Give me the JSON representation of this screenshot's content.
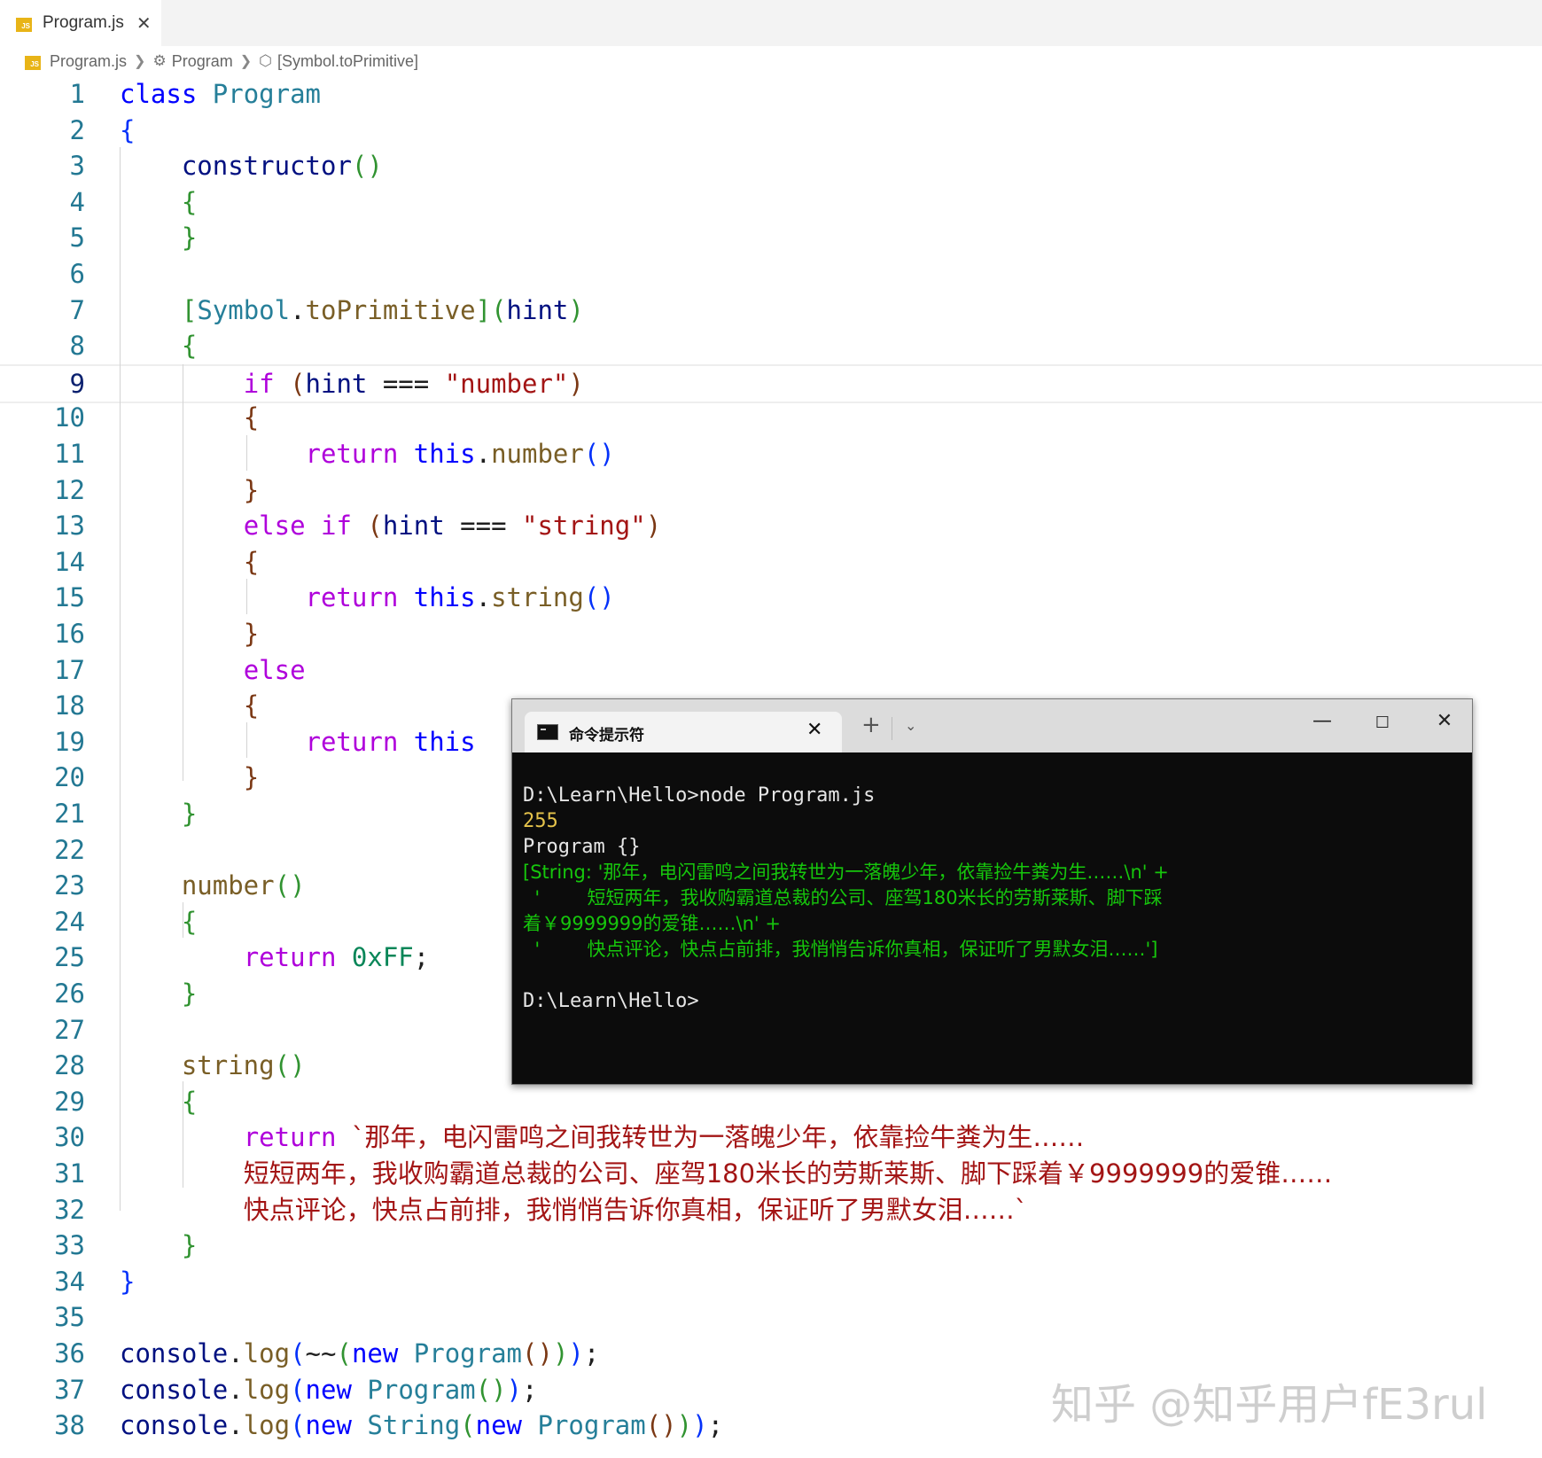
{
  "tab": {
    "filename": "Program.js"
  },
  "breadcrumb": {
    "file": "Program.js",
    "class": "Program",
    "member": "[Symbol.toPrimitive]"
  },
  "editor": {
    "active_line": 9,
    "lines": [
      {
        "n": "1",
        "parts": [
          [
            "kw",
            "class"
          ],
          [
            "",
            " "
          ],
          [
            "ty",
            "Program"
          ]
        ]
      },
      {
        "n": "2",
        "parts": [
          [
            "p1",
            "{"
          ]
        ]
      },
      {
        "n": "3",
        "parts": [
          [
            "",
            "    "
          ],
          [
            "vr",
            "constructor"
          ],
          [
            "p2",
            "()"
          ]
        ]
      },
      {
        "n": "4",
        "parts": [
          [
            "",
            "    "
          ],
          [
            "p2",
            "{"
          ]
        ]
      },
      {
        "n": "5",
        "parts": [
          [
            "",
            "    "
          ],
          [
            "p2",
            "}"
          ]
        ]
      },
      {
        "n": "6",
        "parts": []
      },
      {
        "n": "7",
        "parts": [
          [
            "",
            "    "
          ],
          [
            "p2",
            "["
          ],
          [
            "ty",
            "Symbol"
          ],
          [
            "",
            ".",
            ""
          ],
          [
            "fnb",
            "toPrimitive"
          ],
          [
            "p2",
            "]"
          ],
          [
            "p2",
            "("
          ],
          [
            "vr",
            "hint"
          ],
          [
            "p2",
            ")"
          ]
        ]
      },
      {
        "n": "8",
        "parts": [
          [
            "",
            "    "
          ],
          [
            "p2",
            "{"
          ]
        ]
      },
      {
        "n": "9",
        "parts": [
          [
            "",
            "        "
          ],
          [
            "ct",
            "if"
          ],
          [
            "",
            ""
          ],
          [
            "",
            ""
          ],
          [
            "",
            " "
          ],
          [
            "p3",
            "("
          ],
          [
            "vr",
            "hint"
          ],
          [
            "",
            " === "
          ],
          [
            "str",
            "\"number\""
          ],
          [
            "p3",
            ")"
          ]
        ]
      },
      {
        "n": "10",
        "parts": [
          [
            "",
            "        "
          ],
          [
            "p3",
            "{"
          ]
        ]
      },
      {
        "n": "11",
        "parts": [
          [
            "",
            "            "
          ],
          [
            "ct",
            "return"
          ],
          [
            "",
            " "
          ],
          [
            "kw",
            "this"
          ],
          [
            "",
            "."
          ],
          [
            "fn",
            "number"
          ],
          [
            "p1",
            "()"
          ]
        ]
      },
      {
        "n": "12",
        "parts": [
          [
            "",
            "        "
          ],
          [
            "p3",
            "}"
          ]
        ]
      },
      {
        "n": "13",
        "parts": [
          [
            "",
            "        "
          ],
          [
            "ct",
            "else if"
          ],
          [
            "",
            " "
          ],
          [
            "p3",
            "("
          ],
          [
            "vr",
            "hint"
          ],
          [
            "",
            " === "
          ],
          [
            "str",
            "\"string\""
          ],
          [
            "p3",
            ")"
          ]
        ]
      },
      {
        "n": "14",
        "parts": [
          [
            "",
            "        "
          ],
          [
            "p3",
            "{"
          ]
        ]
      },
      {
        "n": "15",
        "parts": [
          [
            "",
            "            "
          ],
          [
            "ct",
            "return"
          ],
          [
            "",
            " "
          ],
          [
            "kw",
            "this"
          ],
          [
            "",
            "."
          ],
          [
            "fn",
            "string"
          ],
          [
            "p1",
            "()"
          ]
        ]
      },
      {
        "n": "16",
        "parts": [
          [
            "",
            "        "
          ],
          [
            "p3",
            "}"
          ]
        ]
      },
      {
        "n": "17",
        "parts": [
          [
            "",
            "        "
          ],
          [
            "ct",
            "else"
          ]
        ]
      },
      {
        "n": "18",
        "parts": [
          [
            "",
            "        "
          ],
          [
            "p3",
            "{"
          ]
        ]
      },
      {
        "n": "19",
        "parts": [
          [
            "",
            "            "
          ],
          [
            "ct",
            "return"
          ],
          [
            "",
            " "
          ],
          [
            "kw",
            "this"
          ]
        ]
      },
      {
        "n": "20",
        "parts": [
          [
            "",
            "        "
          ],
          [
            "p3",
            "}"
          ]
        ]
      },
      {
        "n": "21",
        "parts": [
          [
            "",
            "    "
          ],
          [
            "p2",
            "}"
          ]
        ]
      },
      {
        "n": "22",
        "parts": []
      },
      {
        "n": "23",
        "parts": [
          [
            "",
            "    "
          ],
          [
            "fn",
            "number"
          ],
          [
            "p2",
            "()"
          ]
        ]
      },
      {
        "n": "24",
        "parts": [
          [
            "",
            "    "
          ],
          [
            "p2",
            "{"
          ]
        ]
      },
      {
        "n": "25",
        "parts": [
          [
            "",
            "        "
          ],
          [
            "ct",
            "return"
          ],
          [
            "",
            " "
          ],
          [
            "num",
            "0xFF"
          ],
          [
            "",
            ";"
          ]
        ]
      },
      {
        "n": "26",
        "parts": [
          [
            "",
            "    "
          ],
          [
            "p2",
            "}"
          ]
        ]
      },
      {
        "n": "27",
        "parts": []
      },
      {
        "n": "28",
        "parts": [
          [
            "",
            "    "
          ],
          [
            "fn",
            "string"
          ],
          [
            "p2",
            "()"
          ]
        ]
      },
      {
        "n": "29",
        "parts": [
          [
            "",
            "    "
          ],
          [
            "p2",
            "{"
          ]
        ]
      },
      {
        "n": "30",
        "parts": [
          [
            "",
            "        "
          ],
          [
            "ct",
            "return"
          ],
          [
            "",
            " "
          ],
          [
            "strc",
            "`那年，电闪雷鸣之间我转世为一落魄少年，依靠捡牛粪为生……"
          ]
        ]
      },
      {
        "n": "31",
        "parts": [
          [
            "",
            "        "
          ],
          [
            "strc",
            "短短两年，我收购霸道总裁的公司、座驾180米长的劳斯莱斯、脚下踩着￥9999999的爱锥……"
          ]
        ]
      },
      {
        "n": "32",
        "parts": [
          [
            "",
            "        "
          ],
          [
            "strc",
            "快点评论，快点占前排，我悄悄告诉你真相，保证听了男默女泪……`"
          ]
        ]
      },
      {
        "n": "33",
        "parts": [
          [
            "",
            "    "
          ],
          [
            "p2",
            "}"
          ]
        ]
      },
      {
        "n": "34",
        "parts": [
          [
            "p1",
            "}"
          ]
        ]
      },
      {
        "n": "35",
        "parts": []
      },
      {
        "n": "36",
        "parts": [
          [
            "ids",
            "console"
          ],
          [
            "",
            "."
          ],
          [
            "fn",
            "log"
          ],
          [
            "p1",
            "("
          ],
          [
            "",
            "~~"
          ],
          [
            "p2",
            "("
          ],
          [
            "kw",
            "new"
          ],
          [
            "",
            " "
          ],
          [
            "ty",
            "Program"
          ],
          [
            "p3",
            "()"
          ],
          [
            "p2",
            ")"
          ],
          [
            "p1",
            ")"
          ],
          [
            "",
            ";"
          ]
        ]
      },
      {
        "n": "37",
        "parts": [
          [
            "ids",
            "console"
          ],
          [
            "",
            "."
          ],
          [
            "fn",
            "log"
          ],
          [
            "p1",
            "("
          ],
          [
            "kw",
            "new"
          ],
          [
            "",
            " "
          ],
          [
            "ty",
            "Program"
          ],
          [
            "p2",
            "()"
          ],
          [
            "p1",
            ")"
          ],
          [
            "",
            ";"
          ]
        ]
      },
      {
        "n": "38",
        "parts": [
          [
            "ids",
            "console"
          ],
          [
            "",
            "."
          ],
          [
            "fn",
            "log"
          ],
          [
            "p1",
            "("
          ],
          [
            "kw",
            "new"
          ],
          [
            "",
            " "
          ],
          [
            "ty",
            "String"
          ],
          [
            "p2",
            "("
          ],
          [
            "kw",
            "new"
          ],
          [
            "",
            " "
          ],
          [
            "ty",
            "Program"
          ],
          [
            "p3",
            "()"
          ],
          [
            "p2",
            ")"
          ],
          [
            "p1",
            ")"
          ],
          [
            "",
            ";"
          ]
        ]
      }
    ]
  },
  "terminal": {
    "tab_title": "命令提示符",
    "lines": [
      {
        "color": "white",
        "text": "D:\\Learn\\Hello>node Program.js"
      },
      {
        "color": "yellow",
        "text": "255"
      },
      {
        "color": "white",
        "text": "Program {}"
      },
      {
        "color": "green",
        "text": "[String: '那年，电闪雷鸣之间我转世为一落魄少年，依靠捡牛粪为生……\\n' +"
      },
      {
        "color": "green",
        "text": "  '        短短两年，我收购霸道总裁的公司、座驾180米长的劳斯莱斯、脚下踩"
      },
      {
        "color": "green",
        "text": "着￥9999999的爱锥……\\n' +"
      },
      {
        "color": "green",
        "text": "  '        快点评论，快点占前排，我悄悄告诉你真相，保证听了男默女泪……']"
      },
      {
        "color": "white",
        "text": ""
      },
      {
        "color": "white",
        "text": "D:\\Learn\\Hello>"
      }
    ]
  },
  "watermark": "知乎 @知乎用户fE3rul"
}
